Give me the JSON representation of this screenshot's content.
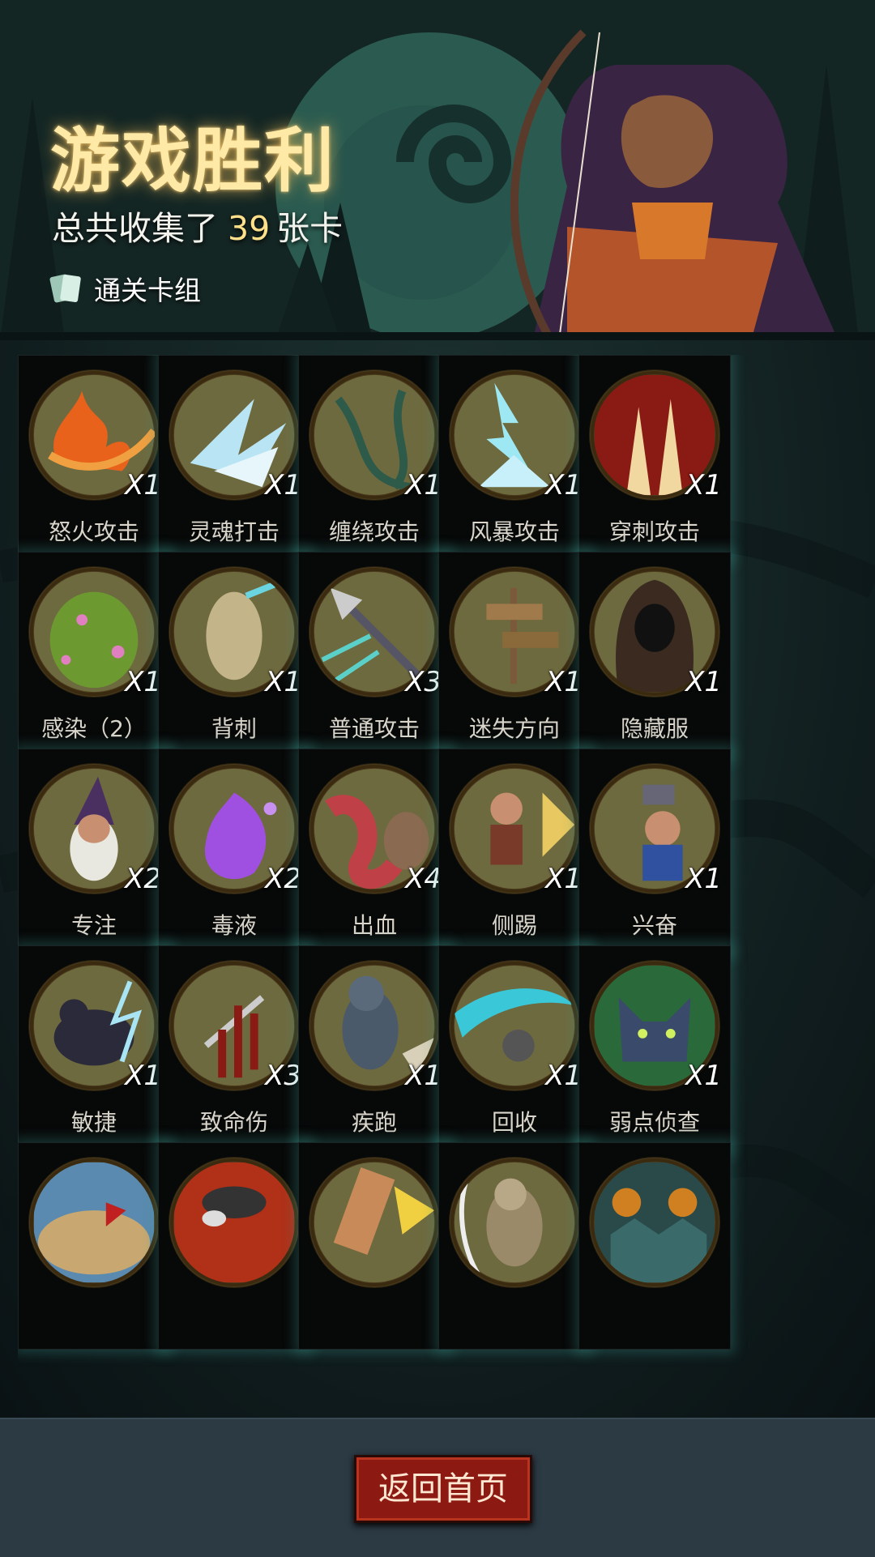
{
  "header": {
    "title": "游戏胜利",
    "collected_prefix": "总共收集了",
    "collected_count": "39",
    "collected_suffix": "张卡",
    "deck_link_label": "通关卡组"
  },
  "cards": [
    {
      "name": "怒火攻击",
      "count": "X1",
      "icon": "fire-slash-icon"
    },
    {
      "name": "灵魂打击",
      "count": "X1",
      "icon": "ice-shards-icon"
    },
    {
      "name": "缠绕攻击",
      "count": "X1",
      "icon": "thorn-vines-icon"
    },
    {
      "name": "风暴攻击",
      "count": "X1",
      "icon": "lightning-storm-icon"
    },
    {
      "name": "穿刺攻击",
      "count": "X1",
      "icon": "spikes-icon"
    },
    {
      "name": "感染（2）",
      "count": "X1",
      "icon": "infected-ogre-icon"
    },
    {
      "name": "背刺",
      "count": "X1",
      "icon": "backstab-dummy-icon"
    },
    {
      "name": "普通攻击",
      "count": "X3",
      "icon": "spear-icon"
    },
    {
      "name": "迷失方向",
      "count": "X1",
      "icon": "signposts-icon"
    },
    {
      "name": "隐藏服",
      "count": "X1",
      "icon": "hooded-cloak-icon"
    },
    {
      "name": "专注",
      "count": "X2",
      "icon": "wizard-icon"
    },
    {
      "name": "毒液",
      "count": "X2",
      "icon": "poison-splash-icon"
    },
    {
      "name": "出血",
      "count": "X4",
      "icon": "tentacle-monster-icon"
    },
    {
      "name": "侧踢",
      "count": "X1",
      "icon": "kicking-dwarf-icon"
    },
    {
      "name": "兴奋",
      "count": "X1",
      "icon": "hammer-dwarf-icon"
    },
    {
      "name": "敏捷",
      "count": "X1",
      "icon": "panther-icon"
    },
    {
      "name": "致命伤",
      "count": "X3",
      "icon": "bleeding-dagger-icon"
    },
    {
      "name": "疾跑",
      "count": "X1",
      "icon": "running-werewolf-icon"
    },
    {
      "name": "回收",
      "count": "X1",
      "icon": "cyan-slash-icon"
    },
    {
      "name": "弱点侦查",
      "count": "X1",
      "icon": "wolf-head-icon"
    },
    {
      "name": "",
      "count": "",
      "icon": "sand-map-flags-icon"
    },
    {
      "name": "",
      "count": "",
      "icon": "red-armor-icon"
    },
    {
      "name": "",
      "count": "",
      "icon": "punch-fist-icon"
    },
    {
      "name": "",
      "count": "",
      "icon": "ghoul-icon"
    },
    {
      "name": "",
      "count": "",
      "icon": "bell-goblins-icon"
    }
  ],
  "bottom": {
    "home_button_label": "返回首页"
  },
  "colors": {
    "title_glow": "#ffe9a6",
    "count_highlight": "#ffe08a",
    "button_red": "#8c1a12",
    "card_glow": "#3c968c",
    "medal_fill": "#6e6a3f"
  }
}
